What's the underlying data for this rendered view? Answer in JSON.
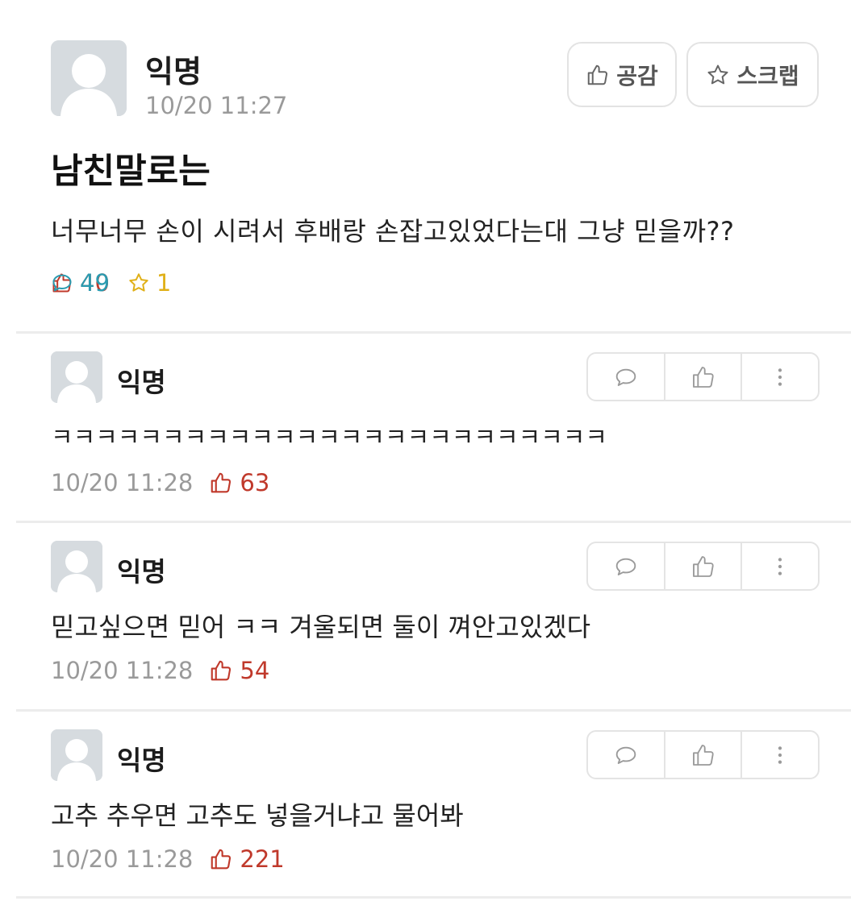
{
  "post": {
    "author": "익명",
    "time": "10/20 11:27",
    "like_button": "공감",
    "scrap_button": "스크랩",
    "title": "남친말로는",
    "body": "너무너무 손이 시려서 후배랑 손잡고있었다는대 그냥 믿을까??",
    "likes": "40",
    "comments": "49",
    "scraps": "1"
  },
  "comments": [
    {
      "author": "익명",
      "text": "ㅋㅋㅋㅋㅋㅋㅋㅋㅋㅋㅋㅋㅋㅋㅋㅋㅋㅋㅋㅋㅋㅋㅋㅋㅋ",
      "time": "10/20 11:28",
      "likes": "63"
    },
    {
      "author": "익명",
      "text": "믿고싶으면 믿어 ㅋㅋ 겨울되면 둘이 껴안고있겠다",
      "time": "10/20 11:28",
      "likes": "54"
    },
    {
      "author": "익명",
      "text": "고추 추우면 고추도 넣을거냐고 물어봐",
      "time": "10/20 11:28",
      "likes": "221"
    }
  ],
  "colors": {
    "like": "#c0392b",
    "comment": "#2a9bb0",
    "scrap": "#e0b018",
    "muted": "#9a9a9a",
    "avatar_bg": "#d6dbdf"
  },
  "icons": {
    "like": "thumbs-up-icon",
    "comment": "speech-bubble-icon",
    "scrap": "star-icon",
    "more": "more-vertical-icon"
  }
}
